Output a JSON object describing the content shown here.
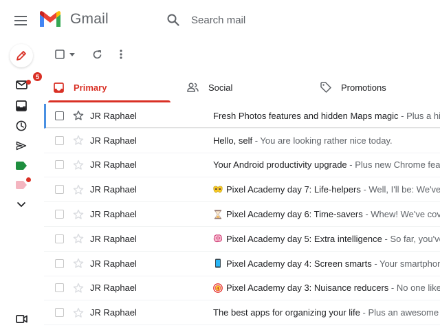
{
  "app": {
    "brand": "Gmail",
    "colors": {
      "accent": "#d93025",
      "icon": "#5f6368",
      "selected_bar": "#4a90e2",
      "label_green": "#1e8e3e",
      "label_pink": "#f4b5c0"
    }
  },
  "search": {
    "placeholder": "Search mail",
    "value": ""
  },
  "rail": {
    "items": [
      {
        "icon": "pencil-icon",
        "name": "compose"
      },
      {
        "icon": "mail-icon",
        "badge": "5"
      },
      {
        "icon": "inbox-icon"
      },
      {
        "icon": "clock-icon"
      },
      {
        "icon": "send-icon"
      },
      {
        "icon": "label-green-icon"
      },
      {
        "icon": "label-pink-icon"
      },
      {
        "icon": "chevron-down-icon"
      },
      {
        "icon": "video-icon"
      }
    ]
  },
  "toolbar": {
    "icons": [
      "select-checkbox-icon",
      "dropdown-arrow-icon",
      "refresh-icon",
      "more-vert-icon"
    ]
  },
  "tabs": [
    {
      "label": "Primary",
      "icon": "inbox-tab-icon",
      "active": true
    },
    {
      "label": "Social",
      "icon": "people-icon",
      "active": false
    },
    {
      "label": "Promotions",
      "icon": "tag-icon",
      "active": false
    }
  ],
  "emails": [
    {
      "sender": "JR Raphael",
      "subject": "Fresh Photos features and hidden Maps magic",
      "snippet": " - Plus a high",
      "emoji": ""
    },
    {
      "sender": "JR Raphael",
      "subject": "Hello, self",
      "snippet": " - You are looking rather nice today.",
      "emoji": ""
    },
    {
      "sender": "JR Raphael",
      "subject": "Your Android productivity upgrade",
      "snippet": " - Plus new Chrome feat",
      "emoji": ""
    },
    {
      "sender": "JR Raphael",
      "subject": "Pixel Academy day 7: Life-helpers",
      "snippet": " - Well, I'll be: We've r",
      "emoji": "mask-emoji"
    },
    {
      "sender": "JR Raphael",
      "subject": "Pixel Academy day 6: Time-savers",
      "snippet": " - Whew! We've cover",
      "emoji": "hourglass-emoji"
    },
    {
      "sender": "JR Raphael",
      "subject": "Pixel Academy day 5: Extra intelligence",
      "snippet": " - So far, you've",
      "emoji": "brain-emoji"
    },
    {
      "sender": "JR Raphael",
      "subject": "Pixel Academy day 4: Screen smarts",
      "snippet": " - Your smartphone",
      "emoji": "phone-emoji"
    },
    {
      "sender": "JR Raphael",
      "subject": "Pixel Academy day 3: Nuisance reducers",
      "snippet": " - No one likes",
      "emoji": "no-entry-emoji"
    },
    {
      "sender": "JR Raphael",
      "subject": "The best apps for organizing your life",
      "snippet": " - Plus an awesome n",
      "emoji": ""
    }
  ]
}
